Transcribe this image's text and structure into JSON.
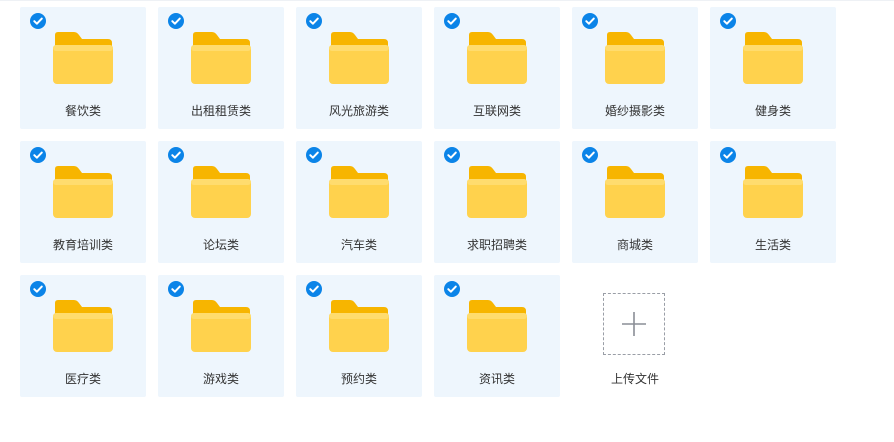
{
  "folders": [
    {
      "label": "餐饮类",
      "selected": true
    },
    {
      "label": "出租租赁类",
      "selected": true
    },
    {
      "label": "风光旅游类",
      "selected": true
    },
    {
      "label": "互联网类",
      "selected": true
    },
    {
      "label": "婚纱摄影类",
      "selected": true
    },
    {
      "label": "健身类",
      "selected": true
    },
    {
      "label": "教育培训类",
      "selected": true
    },
    {
      "label": "论坛类",
      "selected": true
    },
    {
      "label": "汽车类",
      "selected": true
    },
    {
      "label": "求职招聘类",
      "selected": true
    },
    {
      "label": "商城类",
      "selected": true
    },
    {
      "label": "生活类",
      "selected": true
    },
    {
      "label": "医疗类",
      "selected": true
    },
    {
      "label": "游戏类",
      "selected": true
    },
    {
      "label": "预约类",
      "selected": true
    },
    {
      "label": "资讯类",
      "selected": true
    }
  ],
  "upload": {
    "label": "上传文件",
    "icon": "plus-icon"
  },
  "icons": {
    "folder": "folder-icon",
    "check": "check-circle-icon"
  },
  "colors": {
    "tile_bg": "#eef6fd",
    "check_blue": "#0b84e8",
    "folder_front": "#ffd24d",
    "folder_back": "#f7b500"
  }
}
